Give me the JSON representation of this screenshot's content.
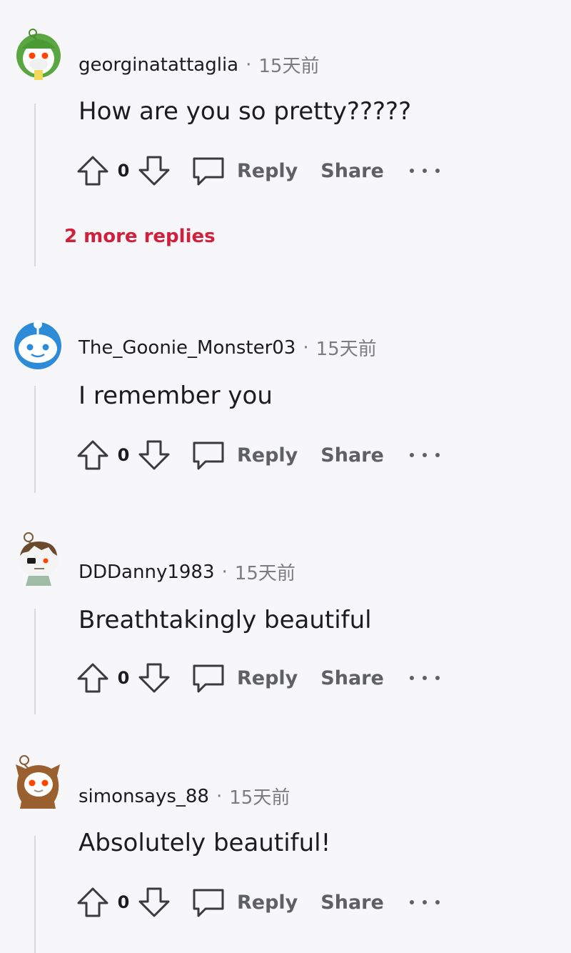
{
  "comments": [
    {
      "username": "georginatattaglia",
      "separator": "·",
      "time": "15天前",
      "body": "How are you so pretty?????",
      "votes": "0",
      "reply_label": "Reply",
      "share_label": "Share",
      "more_replies": "2 more replies"
    },
    {
      "username": "The_Goonie_Monster03",
      "separator": "·",
      "time": "15天前",
      "body": "I remember you",
      "votes": "0",
      "reply_label": "Reply",
      "share_label": "Share"
    },
    {
      "username": "DDDanny1983",
      "separator": "·",
      "time": "15天前",
      "body": "Breathtakingly beautiful",
      "votes": "0",
      "reply_label": "Reply",
      "share_label": "Share"
    },
    {
      "username": "simonsays_88",
      "separator": "·",
      "time": "15天前",
      "body": "Absolutely beautiful!",
      "votes": "0",
      "reply_label": "Reply",
      "share_label": "Share"
    }
  ],
  "colors": {
    "background": "#f7f7fa",
    "more_replies": "#d0203b",
    "action_text": "#5f5f66",
    "thread_line": "#d9d9de"
  },
  "icons": [
    "upvote-arrow-icon",
    "downvote-arrow-icon",
    "comment-bubble-icon",
    "more-dots-icon"
  ]
}
